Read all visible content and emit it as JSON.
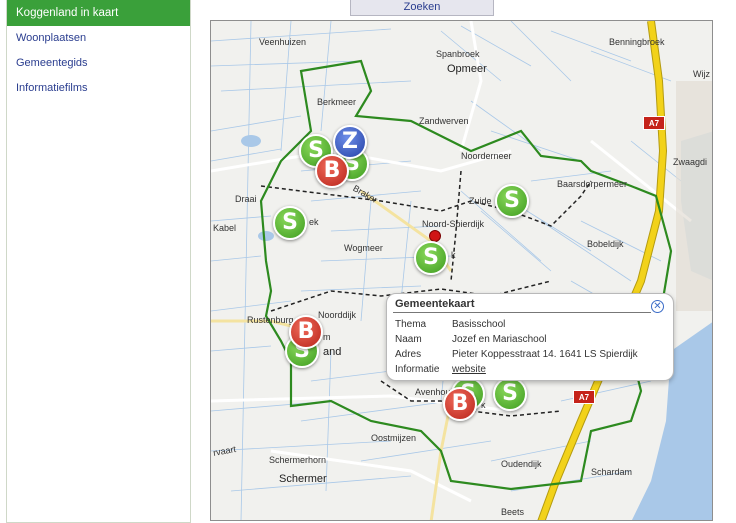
{
  "sidebar": {
    "items": [
      {
        "label": "Koggenland in kaart"
      },
      {
        "label": "Woonplaatsen"
      },
      {
        "label": "Gemeentegids"
      },
      {
        "label": "Informatiefilms"
      }
    ]
  },
  "toolbar": {
    "search_label": "Zoeken"
  },
  "map": {
    "places": [
      "Veenhuizen",
      "Spanbroek",
      "Opmeer",
      "Benningbroek",
      "Wijz",
      "Berkmeer",
      "Zandwerven",
      "Noorderneer",
      "Zwaagdi",
      "Baarsdorpermeer",
      "Zuide",
      "Noord-Spierdijk",
      "Braker",
      "Draai",
      "ek",
      "Kabel",
      "Wogmeer",
      "Bobeldijk",
      "k",
      "Noorddijk",
      "Rustenburg",
      "m",
      "and",
      "Avenhou",
      "k",
      "Oostmijzen",
      "rvaart",
      "Schermerhorn",
      "Schermer",
      "Oudendijk",
      "Schardam",
      "Beets"
    ],
    "road_shields": [
      "A7",
      "A7"
    ],
    "markers": [
      {
        "letter": "S",
        "type": "school"
      },
      {
        "letter": "Z",
        "type": "care"
      },
      {
        "letter": "B",
        "type": "basis"
      },
      {
        "letter": "S",
        "type": "school"
      },
      {
        "letter": "S",
        "type": "school"
      },
      {
        "letter": "S",
        "type": "school"
      },
      {
        "letter": "B",
        "type": "basis"
      },
      {
        "letter": "S",
        "type": "school"
      },
      {
        "letter": "B",
        "type": "basis"
      },
      {
        "letter": "S",
        "type": "school"
      },
      {
        "letter": "S",
        "type": "school"
      }
    ],
    "colors": {
      "boundary": "#2d8a1f",
      "motorway": "#f2d21a",
      "water": "#a9c8e8",
      "school": "#3e9c1f",
      "basis": "#b8231a",
      "care": "#2441a6"
    }
  },
  "popup": {
    "title": "Gemeentekaart",
    "close_icon": "close-icon",
    "rows": [
      {
        "key": "Thema",
        "value": "Basisschool"
      },
      {
        "key": "Naam",
        "value": "Jozef en Mariaschool"
      },
      {
        "key": "Adres",
        "value": "Pieter Koppesstraat 14. 1641 LS Spierdijk"
      },
      {
        "key": "Informatie",
        "value": "website"
      }
    ]
  }
}
